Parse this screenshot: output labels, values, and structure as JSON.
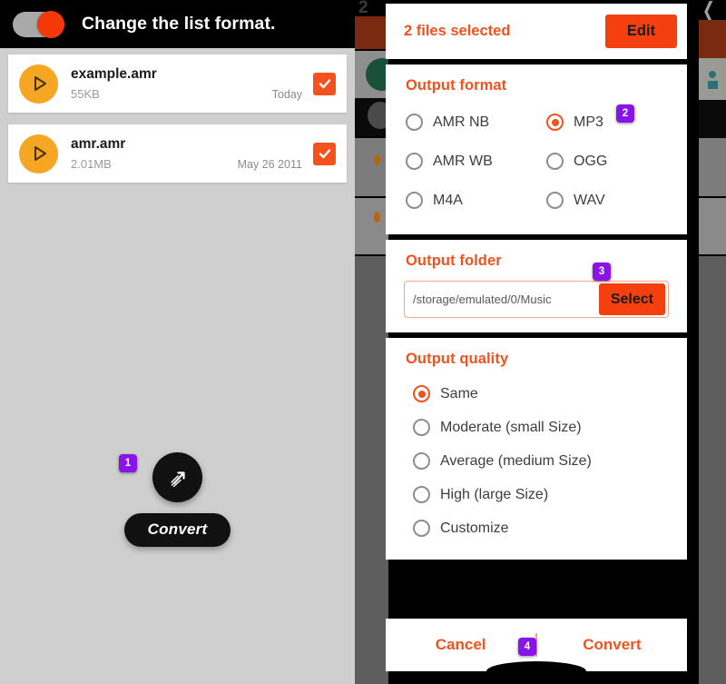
{
  "left_panel": {
    "header": {
      "toggle_state": "on",
      "toggle_icon": "toggle-switch-on-icon",
      "title": "Change the list format."
    },
    "files": [
      {
        "thumb_icon": "play-circle-icon",
        "name": "example.amr",
        "size": "55KB",
        "date": "Today",
        "checked": true,
        "check_icon": "checkmark-icon"
      },
      {
        "thumb_icon": "play-circle-icon",
        "name": "amr.amr",
        "size": "2.01MB",
        "date": "May 26 2011",
        "checked": true,
        "check_icon": "checkmark-icon"
      }
    ],
    "fab": {
      "icon": "convert-arrow-icon",
      "label": "Convert"
    }
  },
  "right_panel": {
    "background": {
      "top_left_number": "2",
      "top_right_icon": "chevron-left-icon"
    },
    "selected_header": {
      "text": "2 files selected",
      "edit_label": "Edit"
    },
    "output_format": {
      "title": "Output format",
      "options": [
        {
          "label": "AMR NB",
          "selected": false
        },
        {
          "label": "MP3",
          "selected": true
        },
        {
          "label": "AMR WB",
          "selected": false
        },
        {
          "label": "OGG",
          "selected": false
        },
        {
          "label": "M4A",
          "selected": false
        },
        {
          "label": "WAV",
          "selected": false
        }
      ]
    },
    "output_folder": {
      "title": "Output folder",
      "path": "/storage/emulated/0/Music",
      "select_label": "Select"
    },
    "output_quality": {
      "title": "Output quality",
      "options": [
        {
          "label": "Same",
          "selected": true
        },
        {
          "label": "Moderate (small Size)",
          "selected": false
        },
        {
          "label": "Average (medium Size)",
          "selected": false
        },
        {
          "label": "High (large Size)",
          "selected": false
        },
        {
          "label": "Customize",
          "selected": false
        }
      ]
    },
    "actions": {
      "cancel_label": "Cancel",
      "convert_label": "Convert"
    }
  },
  "badges": [
    {
      "id": "badge-1",
      "number": "1"
    },
    {
      "id": "badge-2",
      "number": "2"
    },
    {
      "id": "badge-3",
      "number": "3"
    },
    {
      "id": "badge-4",
      "number": "4"
    }
  ],
  "colors": {
    "accent_orange": "#f4511e",
    "button_orange": "#f4400e",
    "thumb_amber": "#f5a623",
    "badge_purple": "#8a13e8",
    "panel_bg_gray": "#cfcfcf",
    "dark": "#111111"
  }
}
